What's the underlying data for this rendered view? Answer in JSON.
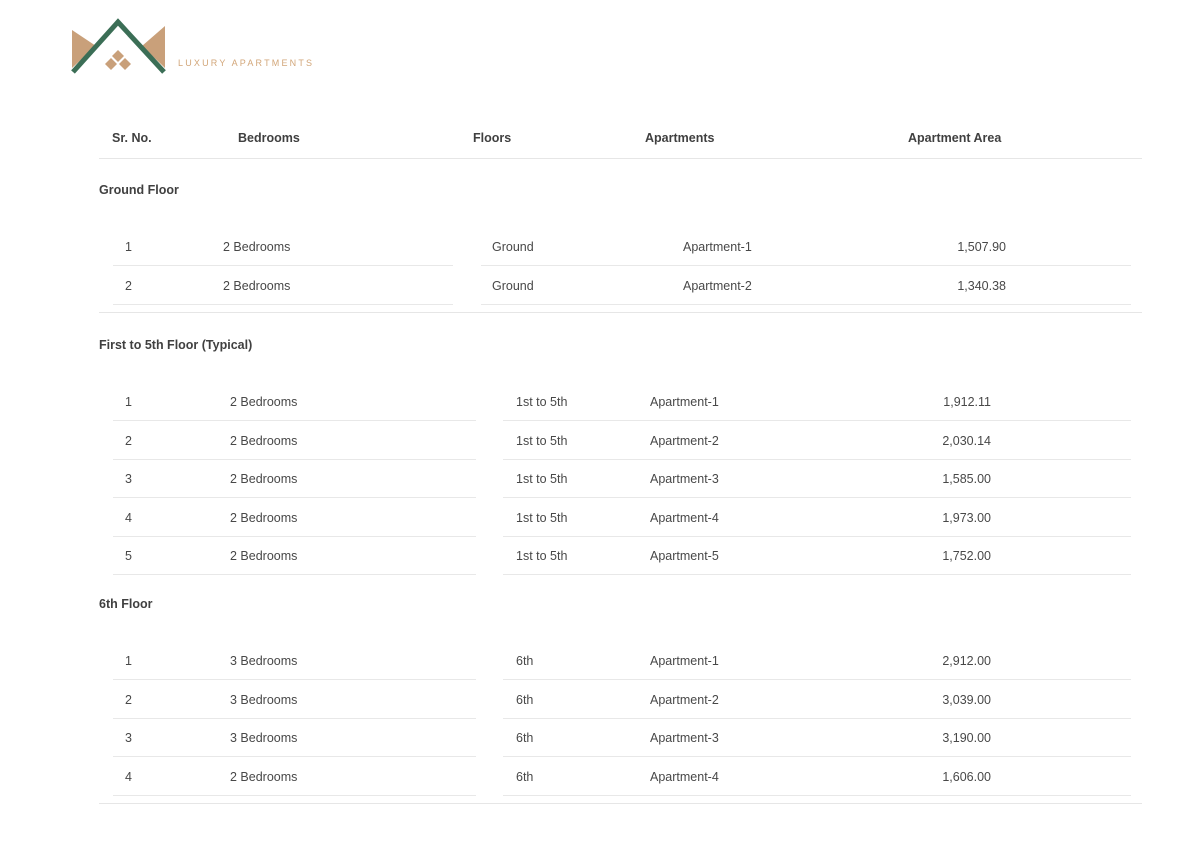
{
  "brand": {
    "tagline": "LUXURY APARTMENTS",
    "colors": {
      "green": "#3b6e56",
      "tan": "#c9a07a"
    }
  },
  "table": {
    "headers": {
      "sr_no": "Sr. No.",
      "bedrooms": "Bedrooms",
      "floors": "Floors",
      "apartments": "Apartments",
      "area": "Apartment Area"
    },
    "sections": [
      {
        "title": "Ground Floor",
        "rows": [
          {
            "sr": "1",
            "bedrooms": "2 Bedrooms",
            "floor": "Ground",
            "apartment": "Apartment-1",
            "area": "1,507.90"
          },
          {
            "sr": "2",
            "bedrooms": "2 Bedrooms",
            "floor": "Ground",
            "apartment": "Apartment-2",
            "area": "1,340.38"
          }
        ]
      },
      {
        "title": "First to 5th Floor (Typical)",
        "rows": [
          {
            "sr": "1",
            "bedrooms": "2 Bedrooms",
            "floor": "1st to 5th",
            "apartment": "Apartment-1",
            "area": "1,912.11"
          },
          {
            "sr": "2",
            "bedrooms": "2 Bedrooms",
            "floor": "1st to 5th",
            "apartment": "Apartment-2",
            "area": "2,030.14"
          },
          {
            "sr": "3",
            "bedrooms": "2 Bedrooms",
            "floor": "1st to 5th",
            "apartment": "Apartment-3",
            "area": "1,585.00"
          },
          {
            "sr": "4",
            "bedrooms": "2 Bedrooms",
            "floor": "1st to 5th",
            "apartment": "Apartment-4",
            "area": "1,973.00"
          },
          {
            "sr": "5",
            "bedrooms": "2 Bedrooms",
            "floor": "1st to 5th",
            "apartment": "Apartment-5",
            "area": "1,752.00"
          }
        ]
      },
      {
        "title": "6th Floor",
        "rows": [
          {
            "sr": "1",
            "bedrooms": "3 Bedrooms",
            "floor": "6th",
            "apartment": "Apartment-1",
            "area": "2,912.00"
          },
          {
            "sr": "2",
            "bedrooms": "3 Bedrooms",
            "floor": "6th",
            "apartment": "Apartment-2",
            "area": "3,039.00"
          },
          {
            "sr": "3",
            "bedrooms": "3 Bedrooms",
            "floor": "6th",
            "apartment": "Apartment-3",
            "area": "3,190.00"
          },
          {
            "sr": "4",
            "bedrooms": "2 Bedrooms",
            "floor": "6th",
            "apartment": "Apartment-4",
            "area": "1,606.00"
          }
        ]
      }
    ]
  }
}
